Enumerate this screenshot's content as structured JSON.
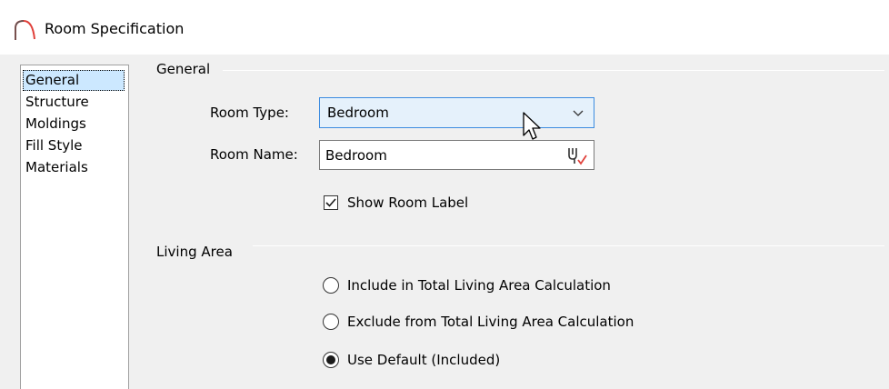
{
  "window": {
    "title": "Room Specification",
    "icon": "arch-icon"
  },
  "nav": {
    "items": [
      {
        "label": "General",
        "selected": true
      },
      {
        "label": "Structure",
        "selected": false
      },
      {
        "label": "Moldings",
        "selected": false
      },
      {
        "label": "Fill Style",
        "selected": false
      },
      {
        "label": "Materials",
        "selected": false
      }
    ]
  },
  "general": {
    "group_title": "General",
    "room_type_label": "Room Type:",
    "room_type_value": "Bedroom",
    "room_name_label": "Room Name:",
    "room_name_value": "Bedroom",
    "show_room_label": {
      "label": "Show Room Label",
      "checked": true
    }
  },
  "living_area": {
    "group_title": "Living Area",
    "options": [
      {
        "label": "Include in Total Living Area Calculation",
        "selected": false
      },
      {
        "label": "Exclude from Total Living Area Calculation",
        "selected": false
      },
      {
        "label": "Use Default (Included)",
        "selected": true
      }
    ]
  },
  "colors": {
    "accent": "#3c8ce0",
    "selection": "#cce8ff",
    "icon_red": "#e0403a"
  }
}
